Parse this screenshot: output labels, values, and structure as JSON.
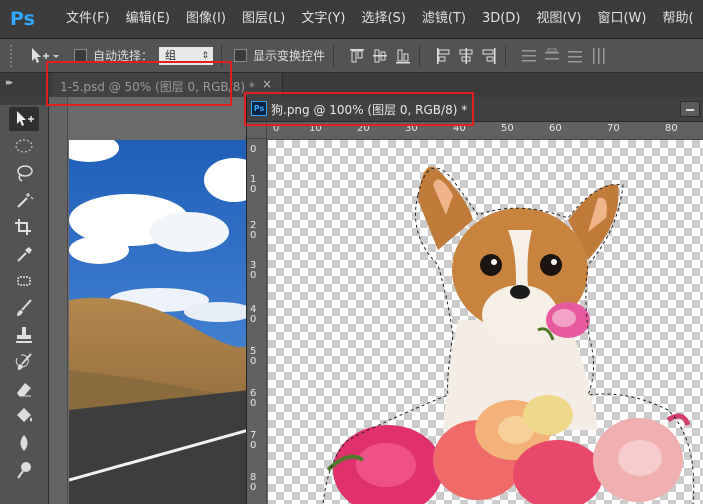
{
  "app": {
    "logo": "Ps"
  },
  "menu": [
    "文件(F)",
    "编辑(E)",
    "图像(I)",
    "图层(L)",
    "文字(Y)",
    "选择(S)",
    "滤镜(T)",
    "3D(D)",
    "视图(V)",
    "窗口(W)",
    "帮助("
  ],
  "options": {
    "auto_select_label": "自动选择：",
    "auto_select_value": "组",
    "show_transform_label": "显示变换控件"
  },
  "tabs": {
    "doc1_label": "1-5.psd @ 50% (图层 0, RGB/8) *",
    "doc1_close": "×",
    "doc2_badge": "Ps",
    "doc2_label": "狗.png @ 100% (图层 0, RGB/8) *"
  },
  "ruler_top": [
    "0",
    "10",
    "20",
    "30",
    "40",
    "50",
    "60",
    "70",
    "80"
  ],
  "ruler_left": [
    "0",
    "1\n0",
    "2\n0",
    "3\n0",
    "4\n0",
    "5\n0",
    "6\n0",
    "7\n0",
    "8\n0"
  ],
  "tools": [
    "move-icon",
    "marquee-icon",
    "lasso-icon",
    "magic-wand-icon",
    "crop-icon",
    "eyedropper-icon",
    "healing-icon",
    "brush-icon",
    "stamp-icon",
    "history-brush-icon",
    "eraser-icon",
    "paint-bucket-icon",
    "blur-icon",
    "dodge-icon"
  ],
  "colors": {
    "accent": "#31a8ff",
    "highlight": "#e02020",
    "menubar": "#3c3c3c",
    "panel": "#535353"
  }
}
